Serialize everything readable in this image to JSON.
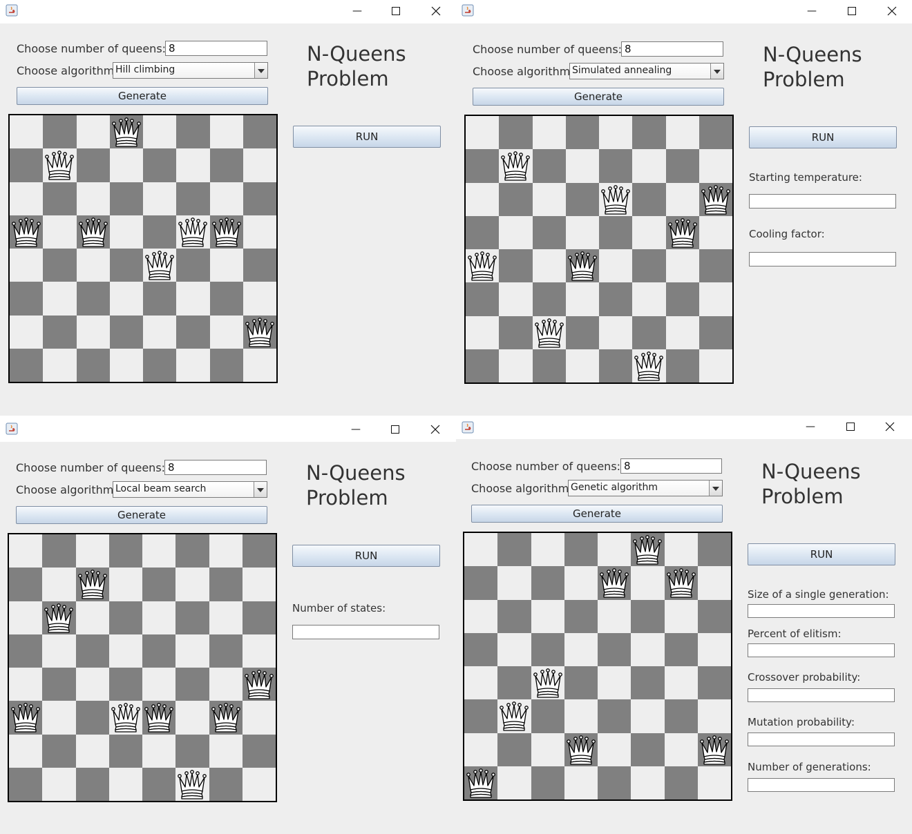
{
  "windows": [
    {
      "id": "hill",
      "queens_label": "Choose number of queens:",
      "queens_value": "8",
      "algorithm_label": "Choose algorithm:",
      "algorithm_value": "Hill climbing",
      "generate_label": "Generate",
      "title_line1": "N-Queens",
      "title_line2": "Problem",
      "run_label": "RUN",
      "params": [],
      "queens": [
        [
          3,
          0
        ],
        [
          1,
          1
        ],
        [
          0,
          3
        ],
        [
          2,
          3
        ],
        [
          5,
          3
        ],
        [
          6,
          3
        ],
        [
          4,
          4
        ],
        [
          7,
          6
        ]
      ]
    },
    {
      "id": "sa",
      "queens_label": "Choose number of queens:",
      "queens_value": "8",
      "algorithm_label": "Choose algorithm:",
      "algorithm_value": "Simulated annealing",
      "generate_label": "Generate",
      "title_line1": "N-Queens",
      "title_line2": "Problem",
      "run_label": "RUN",
      "params": [
        {
          "label": "Starting temperature:",
          "value": ""
        },
        {
          "label": "Cooling factor:",
          "value": ""
        }
      ],
      "queens": [
        [
          1,
          1
        ],
        [
          4,
          2
        ],
        [
          7,
          2
        ],
        [
          6,
          3
        ],
        [
          0,
          4
        ],
        [
          3,
          4
        ],
        [
          2,
          6
        ],
        [
          5,
          7
        ]
      ]
    },
    {
      "id": "beam",
      "queens_label": "Choose number of queens:",
      "queens_value": "8",
      "algorithm_label": "Choose algorithm:",
      "algorithm_value": "Local beam search",
      "generate_label": "Generate",
      "title_line1": "N-Queens",
      "title_line2": "Problem",
      "run_label": "RUN",
      "params": [
        {
          "label": "Number of states:",
          "value": ""
        }
      ],
      "queens": [
        [
          2,
          1
        ],
        [
          1,
          2
        ],
        [
          7,
          4
        ],
        [
          0,
          5
        ],
        [
          3,
          5
        ],
        [
          4,
          5
        ],
        [
          6,
          5
        ],
        [
          5,
          7
        ]
      ]
    },
    {
      "id": "ga",
      "queens_label": "Choose number of queens:",
      "queens_value": "8",
      "algorithm_label": "Choose algorithm:",
      "algorithm_value": "Genetic algorithm",
      "generate_label": "Generate",
      "title_line1": "N-Queens",
      "title_line2": "Problem",
      "run_label": "RUN",
      "params": [
        {
          "label": "Size of a single generation:",
          "value": ""
        },
        {
          "label": "Percent of elitism:",
          "value": ""
        },
        {
          "label": "Crossover probability:",
          "value": ""
        },
        {
          "label": "Mutation probability:",
          "value": ""
        },
        {
          "label": "Number of generations:",
          "value": ""
        }
      ],
      "queens": [
        [
          5,
          0
        ],
        [
          4,
          1
        ],
        [
          6,
          1
        ],
        [
          2,
          4
        ],
        [
          1,
          5
        ],
        [
          3,
          6
        ],
        [
          7,
          6
        ],
        [
          0,
          7
        ]
      ]
    }
  ],
  "colors": {
    "dark_square": "#808080",
    "light_square": "#eeeeee",
    "window_bg": "#eeeeee"
  }
}
